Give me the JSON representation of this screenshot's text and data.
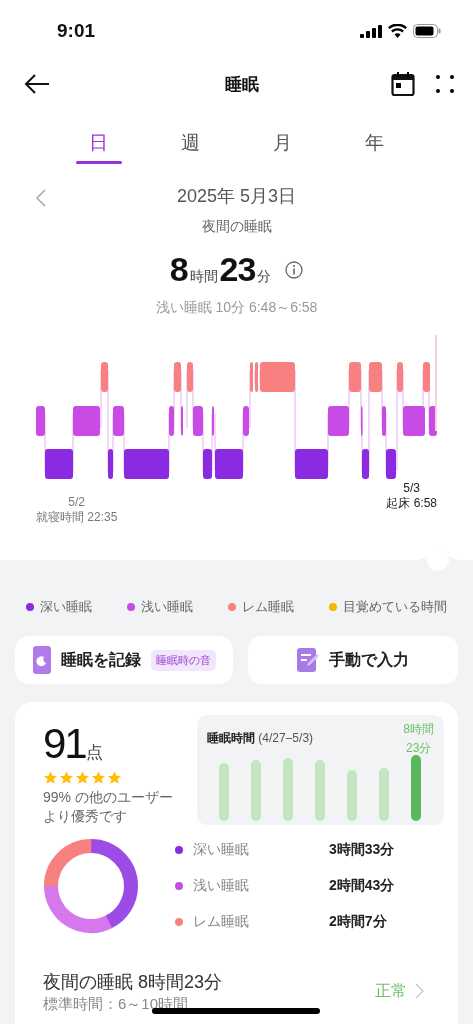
{
  "status_bar": {
    "time": "9:01"
  },
  "header": {
    "title": "睡眠"
  },
  "tabs": [
    {
      "label": "日",
      "selected": true
    },
    {
      "label": "週",
      "selected": false
    },
    {
      "label": "月",
      "selected": false
    },
    {
      "label": "年",
      "selected": false
    }
  ],
  "date": "2025年 5月3日",
  "session_label": "夜間の睡眠",
  "total": {
    "hours": "8",
    "hours_unit": "時間",
    "minutes": "23",
    "minutes_unit": "分"
  },
  "selection_info": "浅い睡眠 10分 6:48～6:58",
  "hypnogram": {
    "start_date": "5/2",
    "start_label": "就寝時間 22:35",
    "end_date": "5/3",
    "end_label": "起床 6:58"
  },
  "legend": [
    {
      "label": "深い睡眠",
      "color": "#8a2be2"
    },
    {
      "label": "浅い睡眠",
      "color": "#c84be6"
    },
    {
      "label": "レム睡眠",
      "color": "#f88080"
    },
    {
      "label": "目覚めている時間",
      "color": "#f5b800"
    }
  ],
  "actions": [
    {
      "kind": "record",
      "label": "睡眠を記録",
      "tag": "睡眠時の音"
    },
    {
      "kind": "manual",
      "label": "手動で入力"
    }
  ],
  "score": {
    "value": "91",
    "unit": "点",
    "stars": 5,
    "comparison": [
      "99% の他のユーザー",
      "より優秀です"
    ]
  },
  "weekly": {
    "title": "睡眠時間",
    "range": "(4/27–5/3)",
    "highlight": "8時間\n23分",
    "bars": [
      {
        "selected": false
      },
      {
        "selected": false
      },
      {
        "selected": false
      },
      {
        "selected": false
      },
      {
        "selected": false
      },
      {
        "selected": false
      },
      {
        "selected": true
      }
    ]
  },
  "breakdown": [
    {
      "label": "深い睡眠",
      "duration": "3時間33分",
      "color": "#8a2be2"
    },
    {
      "label": "浅い睡眠",
      "duration": "2時間43分",
      "color": "#c84be6"
    },
    {
      "label": "レム睡眠",
      "duration": "2時間7分",
      "color": "#f88080"
    }
  ],
  "summary": {
    "title": "夜間の睡眠 8時間23分",
    "standard": "標準時間：6～10時間",
    "status": "正常"
  }
}
